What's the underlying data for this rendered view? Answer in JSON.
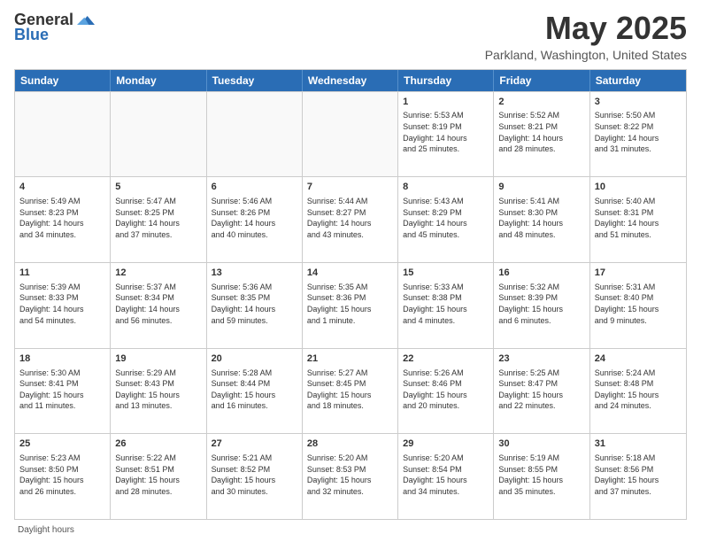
{
  "logo": {
    "general": "General",
    "blue": "Blue"
  },
  "title": "May 2025",
  "location": "Parkland, Washington, United States",
  "header_days": [
    "Sunday",
    "Monday",
    "Tuesday",
    "Wednesday",
    "Thursday",
    "Friday",
    "Saturday"
  ],
  "footer": "Daylight hours",
  "rows": [
    [
      {
        "day": "",
        "content": ""
      },
      {
        "day": "",
        "content": ""
      },
      {
        "day": "",
        "content": ""
      },
      {
        "day": "",
        "content": ""
      },
      {
        "day": "1",
        "content": "Sunrise: 5:53 AM\nSunset: 8:19 PM\nDaylight: 14 hours\nand 25 minutes."
      },
      {
        "day": "2",
        "content": "Sunrise: 5:52 AM\nSunset: 8:21 PM\nDaylight: 14 hours\nand 28 minutes."
      },
      {
        "day": "3",
        "content": "Sunrise: 5:50 AM\nSunset: 8:22 PM\nDaylight: 14 hours\nand 31 minutes."
      }
    ],
    [
      {
        "day": "4",
        "content": "Sunrise: 5:49 AM\nSunset: 8:23 PM\nDaylight: 14 hours\nand 34 minutes."
      },
      {
        "day": "5",
        "content": "Sunrise: 5:47 AM\nSunset: 8:25 PM\nDaylight: 14 hours\nand 37 minutes."
      },
      {
        "day": "6",
        "content": "Sunrise: 5:46 AM\nSunset: 8:26 PM\nDaylight: 14 hours\nand 40 minutes."
      },
      {
        "day": "7",
        "content": "Sunrise: 5:44 AM\nSunset: 8:27 PM\nDaylight: 14 hours\nand 43 minutes."
      },
      {
        "day": "8",
        "content": "Sunrise: 5:43 AM\nSunset: 8:29 PM\nDaylight: 14 hours\nand 45 minutes."
      },
      {
        "day": "9",
        "content": "Sunrise: 5:41 AM\nSunset: 8:30 PM\nDaylight: 14 hours\nand 48 minutes."
      },
      {
        "day": "10",
        "content": "Sunrise: 5:40 AM\nSunset: 8:31 PM\nDaylight: 14 hours\nand 51 minutes."
      }
    ],
    [
      {
        "day": "11",
        "content": "Sunrise: 5:39 AM\nSunset: 8:33 PM\nDaylight: 14 hours\nand 54 minutes."
      },
      {
        "day": "12",
        "content": "Sunrise: 5:37 AM\nSunset: 8:34 PM\nDaylight: 14 hours\nand 56 minutes."
      },
      {
        "day": "13",
        "content": "Sunrise: 5:36 AM\nSunset: 8:35 PM\nDaylight: 14 hours\nand 59 minutes."
      },
      {
        "day": "14",
        "content": "Sunrise: 5:35 AM\nSunset: 8:36 PM\nDaylight: 15 hours\nand 1 minute."
      },
      {
        "day": "15",
        "content": "Sunrise: 5:33 AM\nSunset: 8:38 PM\nDaylight: 15 hours\nand 4 minutes."
      },
      {
        "day": "16",
        "content": "Sunrise: 5:32 AM\nSunset: 8:39 PM\nDaylight: 15 hours\nand 6 minutes."
      },
      {
        "day": "17",
        "content": "Sunrise: 5:31 AM\nSunset: 8:40 PM\nDaylight: 15 hours\nand 9 minutes."
      }
    ],
    [
      {
        "day": "18",
        "content": "Sunrise: 5:30 AM\nSunset: 8:41 PM\nDaylight: 15 hours\nand 11 minutes."
      },
      {
        "day": "19",
        "content": "Sunrise: 5:29 AM\nSunset: 8:43 PM\nDaylight: 15 hours\nand 13 minutes."
      },
      {
        "day": "20",
        "content": "Sunrise: 5:28 AM\nSunset: 8:44 PM\nDaylight: 15 hours\nand 16 minutes."
      },
      {
        "day": "21",
        "content": "Sunrise: 5:27 AM\nSunset: 8:45 PM\nDaylight: 15 hours\nand 18 minutes."
      },
      {
        "day": "22",
        "content": "Sunrise: 5:26 AM\nSunset: 8:46 PM\nDaylight: 15 hours\nand 20 minutes."
      },
      {
        "day": "23",
        "content": "Sunrise: 5:25 AM\nSunset: 8:47 PM\nDaylight: 15 hours\nand 22 minutes."
      },
      {
        "day": "24",
        "content": "Sunrise: 5:24 AM\nSunset: 8:48 PM\nDaylight: 15 hours\nand 24 minutes."
      }
    ],
    [
      {
        "day": "25",
        "content": "Sunrise: 5:23 AM\nSunset: 8:50 PM\nDaylight: 15 hours\nand 26 minutes."
      },
      {
        "day": "26",
        "content": "Sunrise: 5:22 AM\nSunset: 8:51 PM\nDaylight: 15 hours\nand 28 minutes."
      },
      {
        "day": "27",
        "content": "Sunrise: 5:21 AM\nSunset: 8:52 PM\nDaylight: 15 hours\nand 30 minutes."
      },
      {
        "day": "28",
        "content": "Sunrise: 5:20 AM\nSunset: 8:53 PM\nDaylight: 15 hours\nand 32 minutes."
      },
      {
        "day": "29",
        "content": "Sunrise: 5:20 AM\nSunset: 8:54 PM\nDaylight: 15 hours\nand 34 minutes."
      },
      {
        "day": "30",
        "content": "Sunrise: 5:19 AM\nSunset: 8:55 PM\nDaylight: 15 hours\nand 35 minutes."
      },
      {
        "day": "31",
        "content": "Sunrise: 5:18 AM\nSunset: 8:56 PM\nDaylight: 15 hours\nand 37 minutes."
      }
    ]
  ]
}
